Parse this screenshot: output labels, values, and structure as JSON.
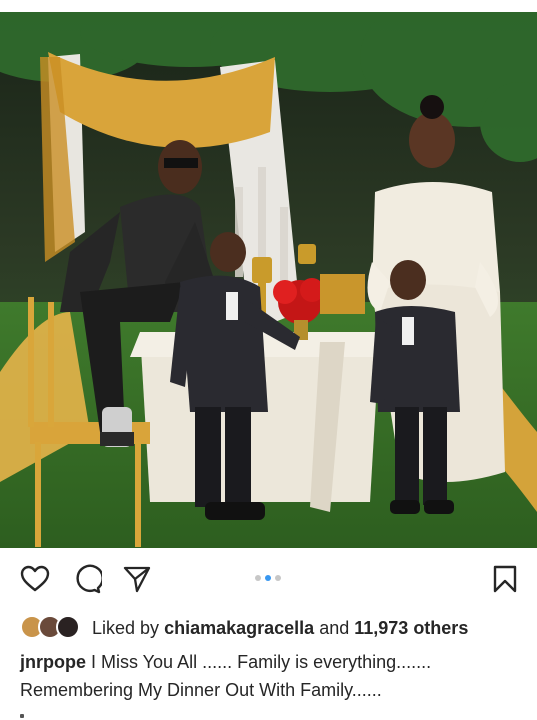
{
  "post": {
    "photo_icon": "family-photo",
    "carousel": {
      "count": 3,
      "active_index": 1
    },
    "actions": {
      "like_icon": "heart-icon",
      "comment_icon": "comment-icon",
      "share_icon": "send-icon",
      "save_icon": "bookmark-icon"
    },
    "likes": {
      "prefix": "Liked by",
      "user": "chiamakagracella",
      "conjunction": "and",
      "others": "11,973 others"
    },
    "caption": {
      "username": "jnrpope",
      "line1": "I Miss You All ...... Family is everything.......",
      "line2": "Remembering My Dinner Out With Family......"
    }
  },
  "colors": {
    "pager_active": "#3897f0",
    "pager_inactive": "#c7c7c7",
    "text": "#262626"
  }
}
